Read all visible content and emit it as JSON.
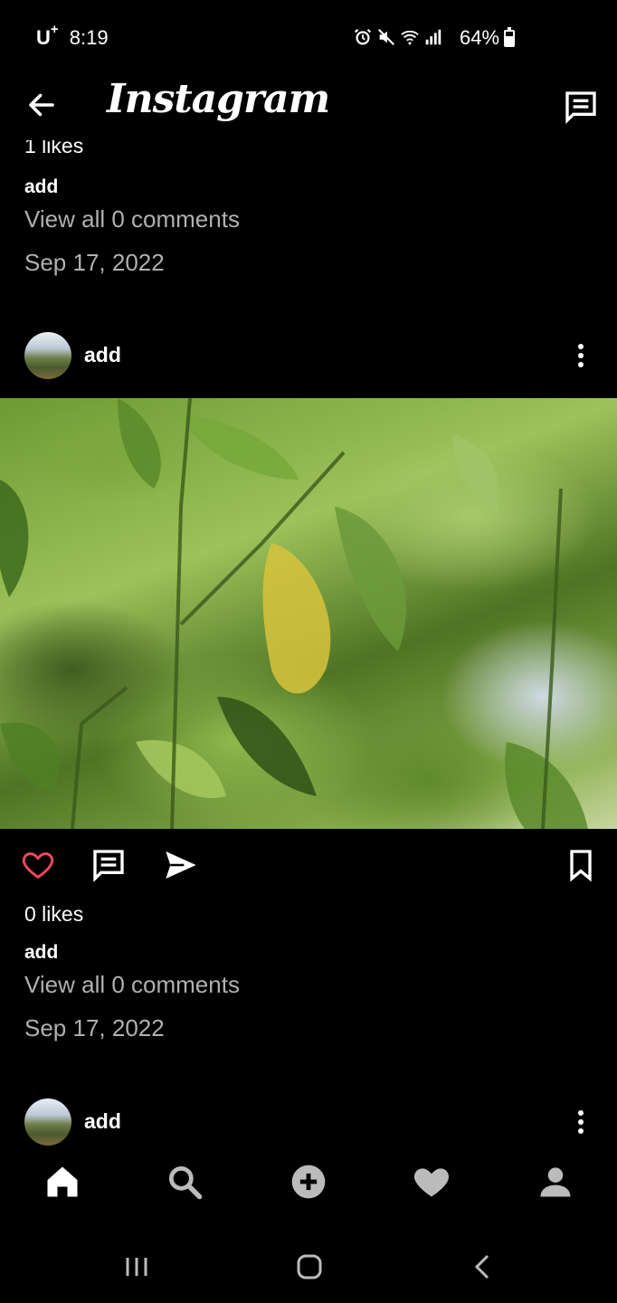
{
  "status_bar": {
    "carrier": "U",
    "carrier_sup": "+",
    "time": "8:19",
    "battery_text": "64%",
    "battery_level": 0.64,
    "icons": [
      "alarm-icon",
      "mute-icon",
      "wifi-icon",
      "signal-icon",
      "battery-icon"
    ]
  },
  "app_bar": {
    "title": "Instagram",
    "back_icon": "arrow-left-icon",
    "messages_icon": "message-icon"
  },
  "feed": {
    "partial_post": {
      "likes": "1 likes",
      "caption_user": "add",
      "comments_link": "View all 0 comments",
      "date": "Sep 17, 2022"
    },
    "post": {
      "username": "add",
      "likes": "0 likes",
      "caption_user": "add",
      "comments_link": "View all 0 comments",
      "date": "Sep 17, 2022",
      "liked_color": "#ed4956"
    },
    "next_post": {
      "username": "add"
    }
  },
  "bottom_nav": {
    "items": [
      "home-icon",
      "search-icon",
      "add-icon",
      "heart-icon",
      "profile-icon"
    ]
  },
  "system_nav": {
    "items": [
      "recents-icon",
      "home-circle-icon",
      "back-chevron-icon"
    ]
  }
}
